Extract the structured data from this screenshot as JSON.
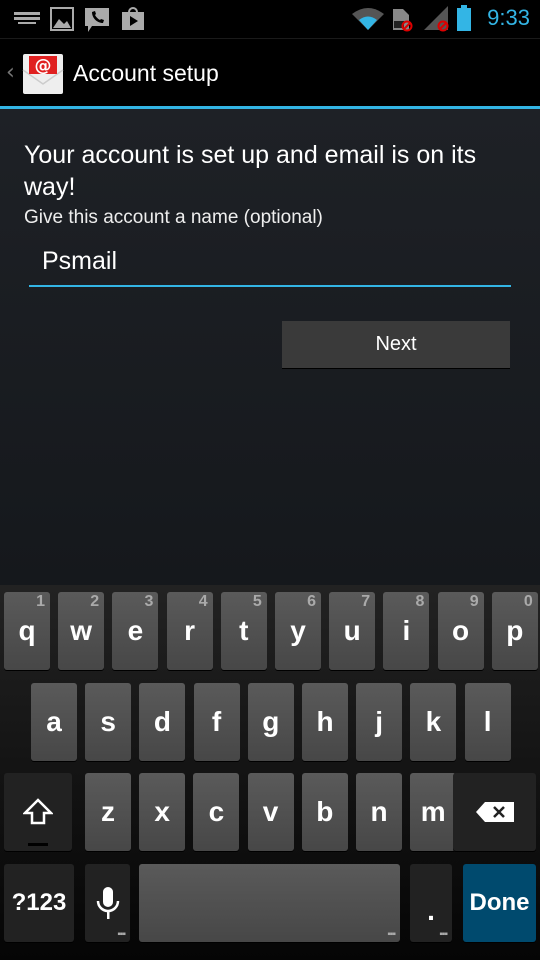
{
  "status_bar": {
    "time": "9:33",
    "icons_left": [
      "keyboard-icon",
      "image-icon",
      "phone-message-icon",
      "play-store-icon"
    ],
    "icons_right": [
      "wifi-icon",
      "sim-no-icon",
      "signal-no-icon",
      "battery-icon"
    ],
    "accent": "#33b5e5"
  },
  "action_bar": {
    "title": "Account setup",
    "app_icon": "email-app-icon"
  },
  "content": {
    "heading": "Your account is set up and email is on its way!",
    "label": "Give this account a name (optional)",
    "name_value": "Psmail",
    "next_label": "Next"
  },
  "keyboard": {
    "row1": [
      {
        "k": "q",
        "h": "1"
      },
      {
        "k": "w",
        "h": "2"
      },
      {
        "k": "e",
        "h": "3"
      },
      {
        "k": "r",
        "h": "4"
      },
      {
        "k": "t",
        "h": "5"
      },
      {
        "k": "y",
        "h": "6"
      },
      {
        "k": "u",
        "h": "7"
      },
      {
        "k": "i",
        "h": "8"
      },
      {
        "k": "o",
        "h": "9"
      },
      {
        "k": "p",
        "h": "0"
      }
    ],
    "row2": [
      "a",
      "s",
      "d",
      "f",
      "g",
      "h",
      "j",
      "k",
      "l"
    ],
    "row3": [
      "z",
      "x",
      "c",
      "v",
      "b",
      "n",
      "m"
    ],
    "symbols_label": "?123",
    "period_label": ".",
    "done_label": "Done",
    "done_color": "#004a6e"
  }
}
